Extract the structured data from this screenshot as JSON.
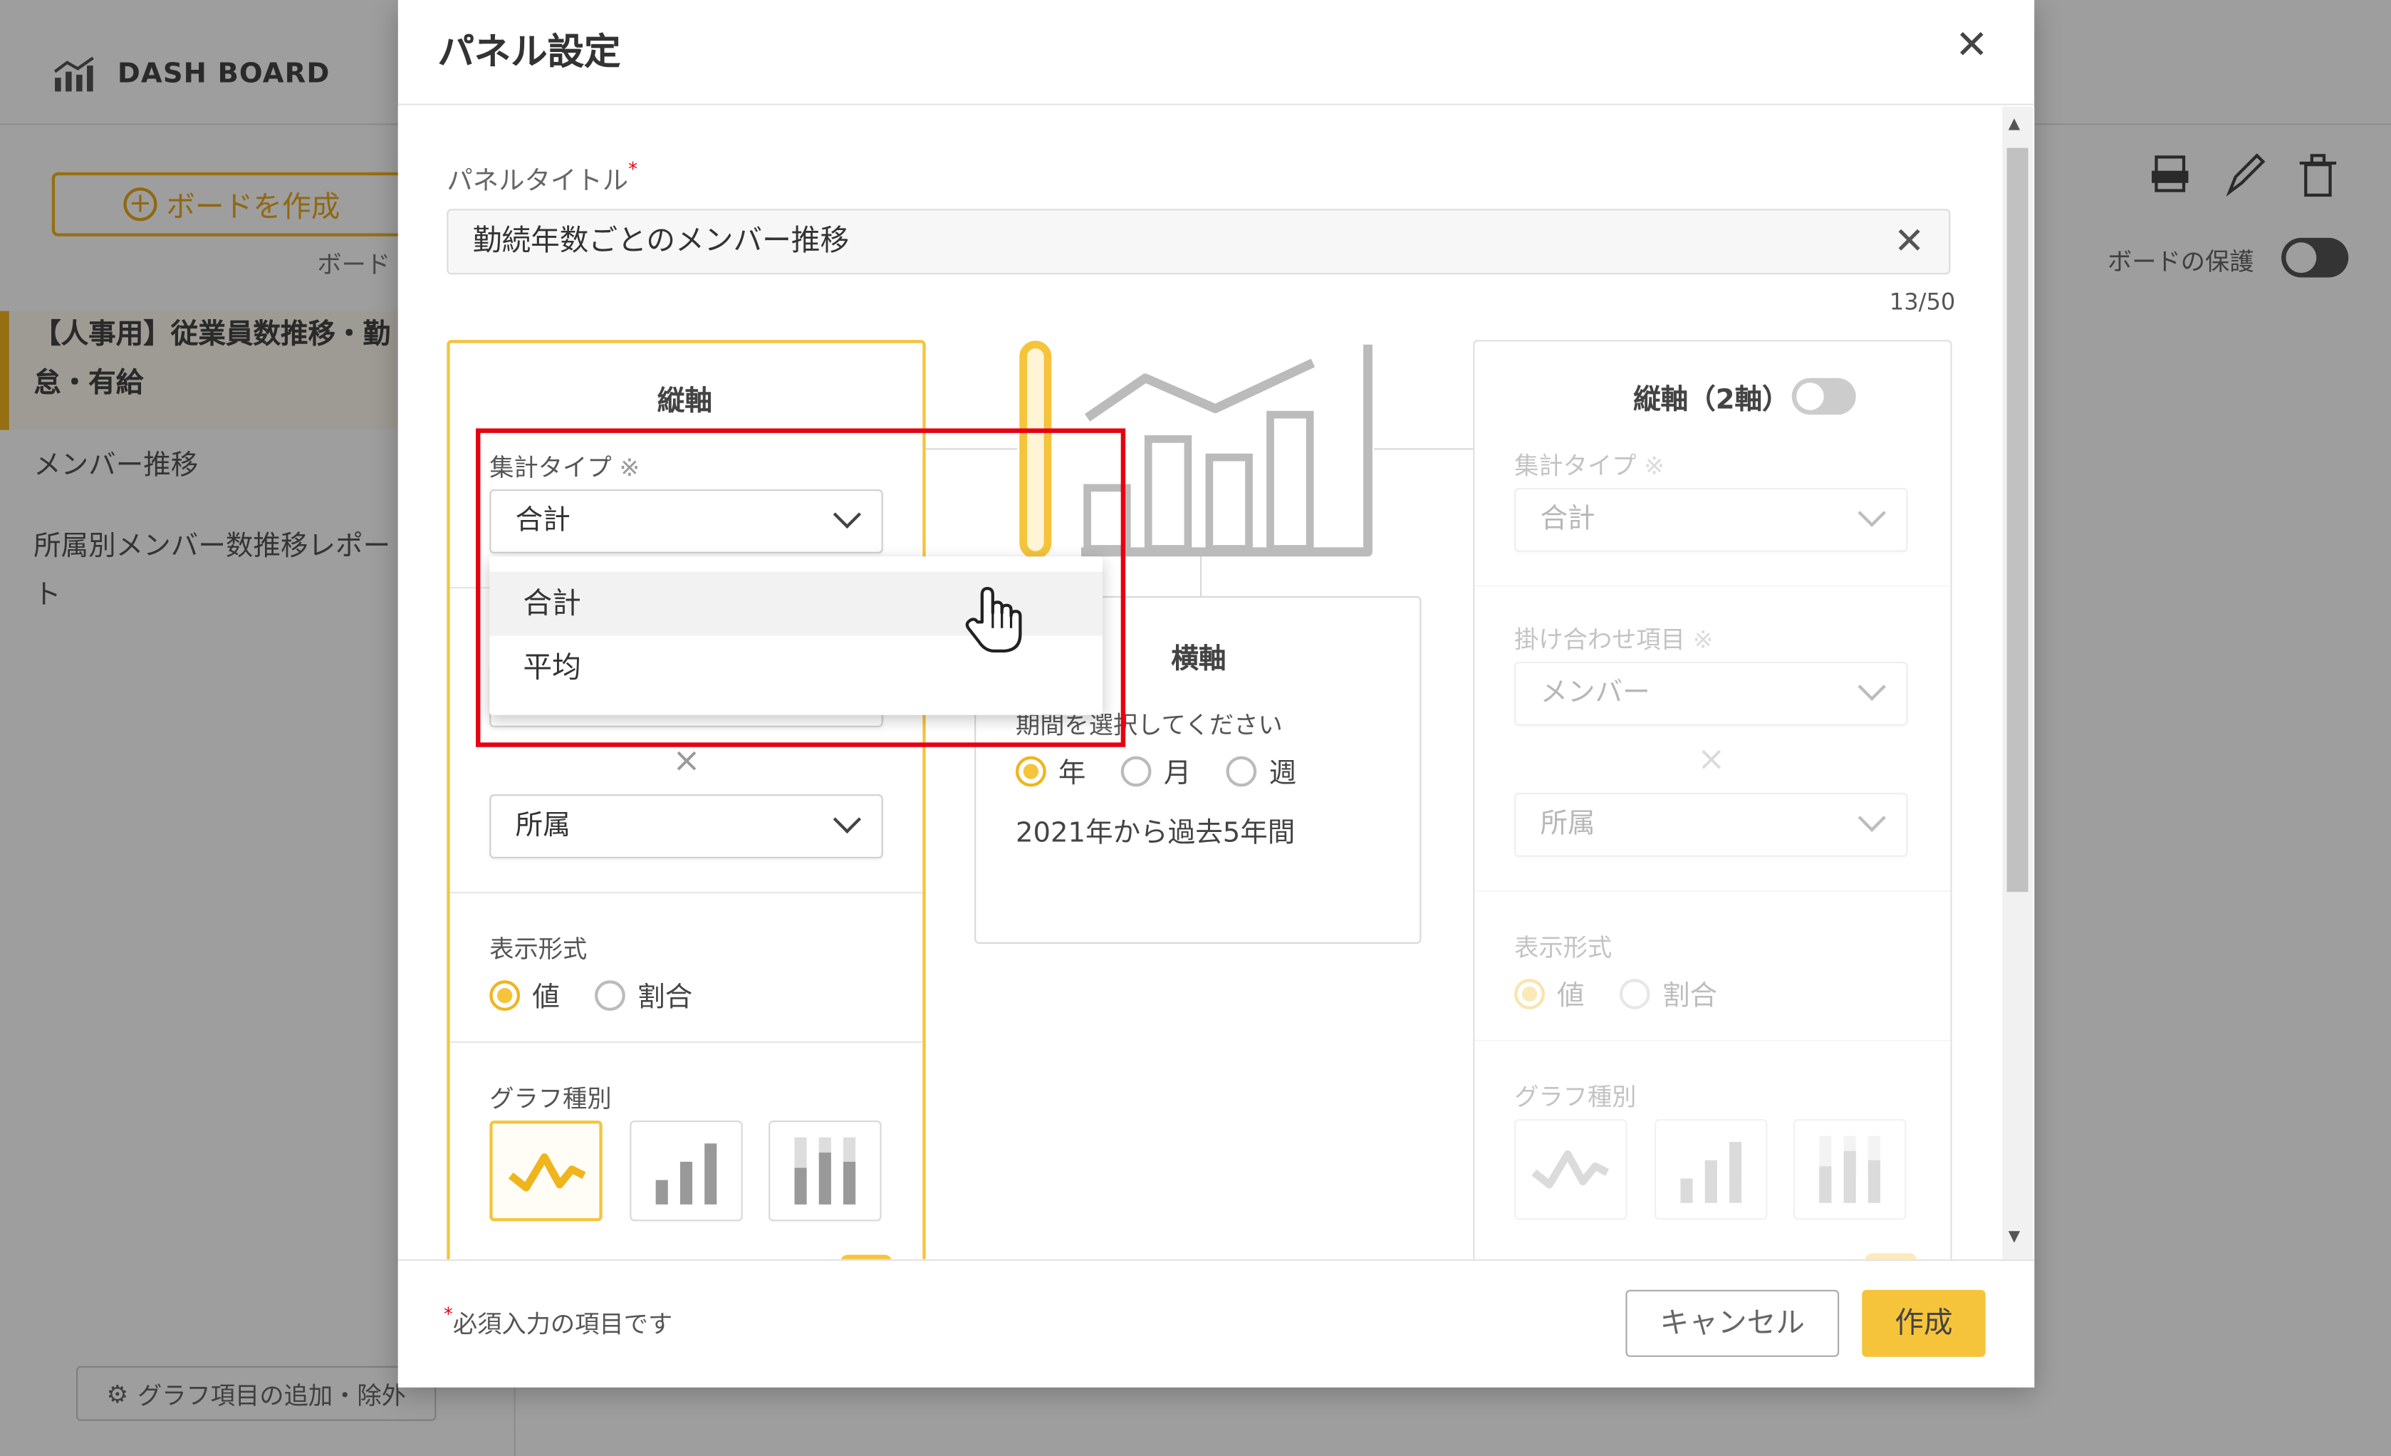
{
  "app": {
    "title": "DASH BOARD",
    "create_board_label": "ボードを作成",
    "board_caption": "ボード",
    "sidebar_items": [
      "【人事用】従業員数推移・勤",
      "怠・有給",
      "メンバー推移",
      "所属別メンバー数推移レポー",
      "ト"
    ],
    "footer_button_label": "グラフ項目の追加・除外",
    "protect_label": "ボードの保護",
    "icons": [
      "pdf-icon",
      "pencil-icon",
      "trash-icon"
    ]
  },
  "modal": {
    "title": "パネル設定",
    "panel_title_label": "パネルタイトル",
    "required_mark": "*",
    "panel_title_value": "勤続年数ごとのメンバー推移",
    "char_counter": "13/50",
    "left_axis": {
      "heading": "縦軸",
      "agg_label": "集計タイプ",
      "agg_note": "※",
      "agg_value": "合計",
      "times_mark": "×",
      "group_value": "所属",
      "display_label": "表示形式",
      "display_options": [
        "値",
        "割合"
      ],
      "display_selected": "値",
      "graph_label": "グラフ種別"
    },
    "dropdown": {
      "options": [
        "合計",
        "平均"
      ],
      "hovered": "合計"
    },
    "x_axis": {
      "heading": "横軸",
      "period_label": "期間を選択してください",
      "options": [
        "年",
        "月",
        "週"
      ],
      "selected": "年",
      "summary": "2021年から過去5年間"
    },
    "right_axis": {
      "heading": "縦軸（2軸）",
      "agg_label": "集計タイプ",
      "agg_note": "※",
      "agg_value": "合計",
      "cross_label": "掛け合わせ項目",
      "cross_note": "※",
      "cross_value": "メンバー",
      "times_mark": "×",
      "group_value": "所属",
      "display_label": "表示形式",
      "display_options": [
        "値",
        "割合"
      ],
      "graph_label": "グラフ種別"
    },
    "footer": {
      "required_note": "必須入力の項目です",
      "cancel_label": "キャンセル",
      "create_label": "作成"
    },
    "accent_color": "#f5c43a",
    "highlight_color": "#e60012"
  }
}
